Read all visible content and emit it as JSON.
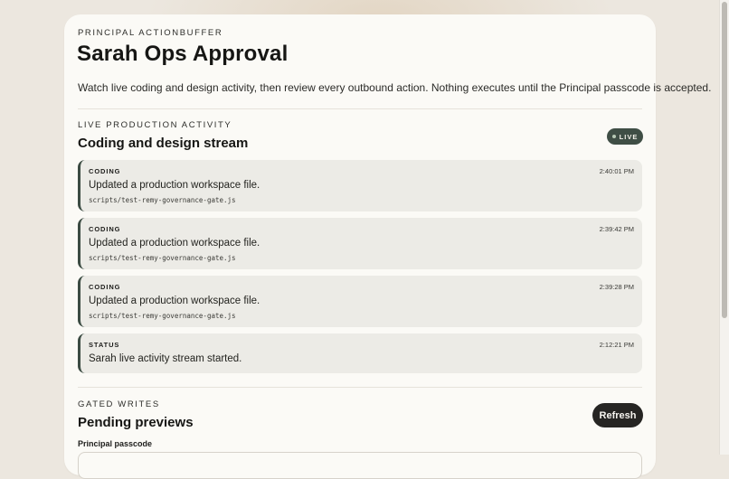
{
  "header": {
    "eyebrow": "PRINCIPAL ACTIONBUFFER",
    "title": "Sarah Ops Approval",
    "subtitle": "Watch live coding and design activity, then review every outbound action. Nothing executes until the Principal passcode is accepted."
  },
  "activity": {
    "eyebrow": "LIVE PRODUCTION ACTIVITY",
    "title": "Coding and design stream",
    "badge": "LIVE",
    "entries": [
      {
        "kind": "CODING",
        "time": "2:40:01 PM",
        "message": "Updated a production workspace file.",
        "file": "scripts/test-remy-governance-gate.js"
      },
      {
        "kind": "CODING",
        "time": "2:39:42 PM",
        "message": "Updated a production workspace file.",
        "file": "scripts/test-remy-governance-gate.js"
      },
      {
        "kind": "CODING",
        "time": "2:39:28 PM",
        "message": "Updated a production workspace file.",
        "file": "scripts/test-remy-governance-gate.js"
      },
      {
        "kind": "STATUS",
        "time": "2:12:21 PM",
        "message": "Sarah live activity stream started.",
        "file": ""
      }
    ]
  },
  "gated": {
    "eyebrow": "GATED WRITES",
    "title": "Pending previews",
    "refresh_label": "Refresh",
    "passcode_label": "Principal passcode",
    "passcode_value": ""
  },
  "colors": {
    "background": "#ece7df",
    "card": "#fbfaf6",
    "accent": "#3f4e45",
    "entry_bg": "#ecebe6",
    "button": "#262523"
  }
}
